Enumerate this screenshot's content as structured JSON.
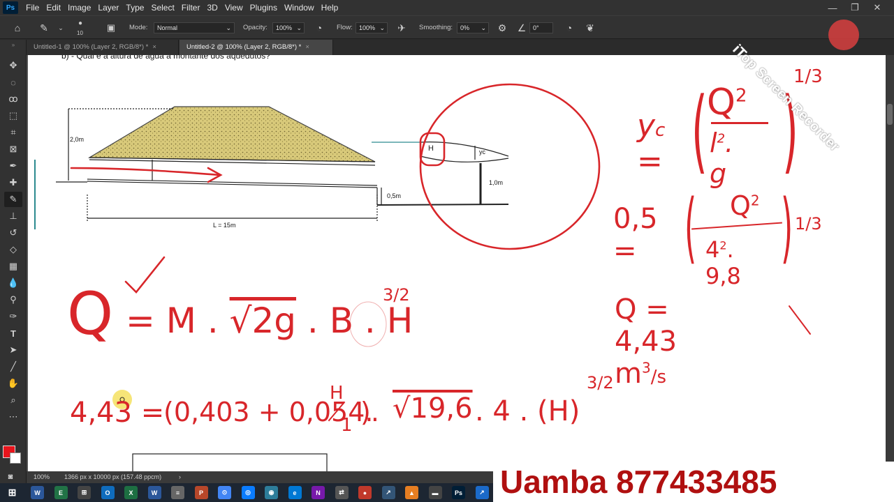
{
  "app": {
    "logo": "Ps"
  },
  "menubar": [
    "File",
    "Edit",
    "Image",
    "Layer",
    "Type",
    "Select",
    "Filter",
    "3D",
    "View",
    "Plugins",
    "Window",
    "Help"
  ],
  "window_controls": {
    "minimize": "—",
    "restore": "❐",
    "close": "✕"
  },
  "options": {
    "brush_size": "10",
    "mode_label": "Mode:",
    "mode_value": "Normal",
    "opacity_label": "Opacity:",
    "opacity_value": "100%",
    "flow_label": "Flow:",
    "flow_value": "100%",
    "smoothing_label": "Smoothing:",
    "smoothing_value": "0%",
    "angle_value": "0°"
  },
  "tabs": [
    {
      "label": "Untitled-1 @ 100% (Layer 2, RGB/8*) *",
      "close": "×"
    },
    {
      "label": "Untitled-2 @ 100% (Layer 2, RGB/8*) *",
      "close": "×"
    }
  ],
  "tools": [
    "move-tool",
    "marquee-tool",
    "lasso-tool",
    "object-select-tool",
    "crop-tool",
    "frame-tool",
    "eyedropper-tool",
    "healing-tool",
    "brush-tool",
    "stamp-tool",
    "history-brush-tool",
    "eraser-tool",
    "gradient-tool",
    "blur-tool",
    "dodge-tool",
    "pen-tool",
    "type-tool",
    "path-select-tool",
    "line-tool",
    "hand-tool",
    "zoom-tool",
    "more-tools"
  ],
  "colors": {
    "foreground": "#e8141c",
    "background": "#ffffff",
    "ink": "#d8262a",
    "sand": "#d8c97a",
    "watermark": "#b01010"
  },
  "document": {
    "question": "b)   - Qual é a altura de água à montante dos aquedutos?",
    "dim_2m": "2,0m",
    "dim_05m": "0,5m",
    "dim_1m": "1,0m",
    "dim_L": "L = 15m",
    "label_yc": "yc",
    "label_H": "H"
  },
  "handwriting": {
    "yc_eq_lhs": "y",
    "yc_eq_sub": "c",
    "yc_eq_eq": "=",
    "yc_num": "Q",
    "yc_num_exp": "2",
    "yc_den": "l",
    "yc_den_exp": "2",
    "yc_den_rest": ". g",
    "yc_power": "1/3",
    "eq2_lhs": "0,5 =",
    "eq2_num": "Q",
    "eq2_num_exp": "2",
    "eq2_den": "4",
    "eq2_den_exp": "2",
    "eq2_den_rest": ". 9,8",
    "eq2_power": "1/3",
    "q_result": "Q = 4,43 m",
    "q_result_exp": "3",
    "q_result_unit": "/s",
    "formula_Q": "Q",
    "formula_body": "= M . ",
    "formula_sqrt": "√2g",
    "formula_tail": " . B . ",
    "formula_H": "H",
    "formula_power": "3/2",
    "subst_lhs": "4,43 =",
    "subst_paren": "(0,403 + 0,054.",
    "subst_frac_num": "H",
    "subst_frac_den": "1",
    "subst_close": ").",
    "subst_sqrt": "√19,6",
    "subst_tail": ". 4 . (H)",
    "subst_power": "3/2"
  },
  "status": {
    "zoom": "100%",
    "doc_info": "1366 px x 10000 px (157.48 ppcm)"
  },
  "watermark": {
    "recorder": "iTop Screen Recorder",
    "phone": "Uamba 877433485"
  },
  "taskbar": [
    "W",
    "E",
    "⊞",
    "O",
    "X",
    "W",
    "≡",
    "P",
    "⊙",
    "◎",
    "◉",
    "e",
    "N",
    "⇄",
    "●",
    "↗",
    "▲",
    "▬",
    "Ps",
    "↗"
  ]
}
